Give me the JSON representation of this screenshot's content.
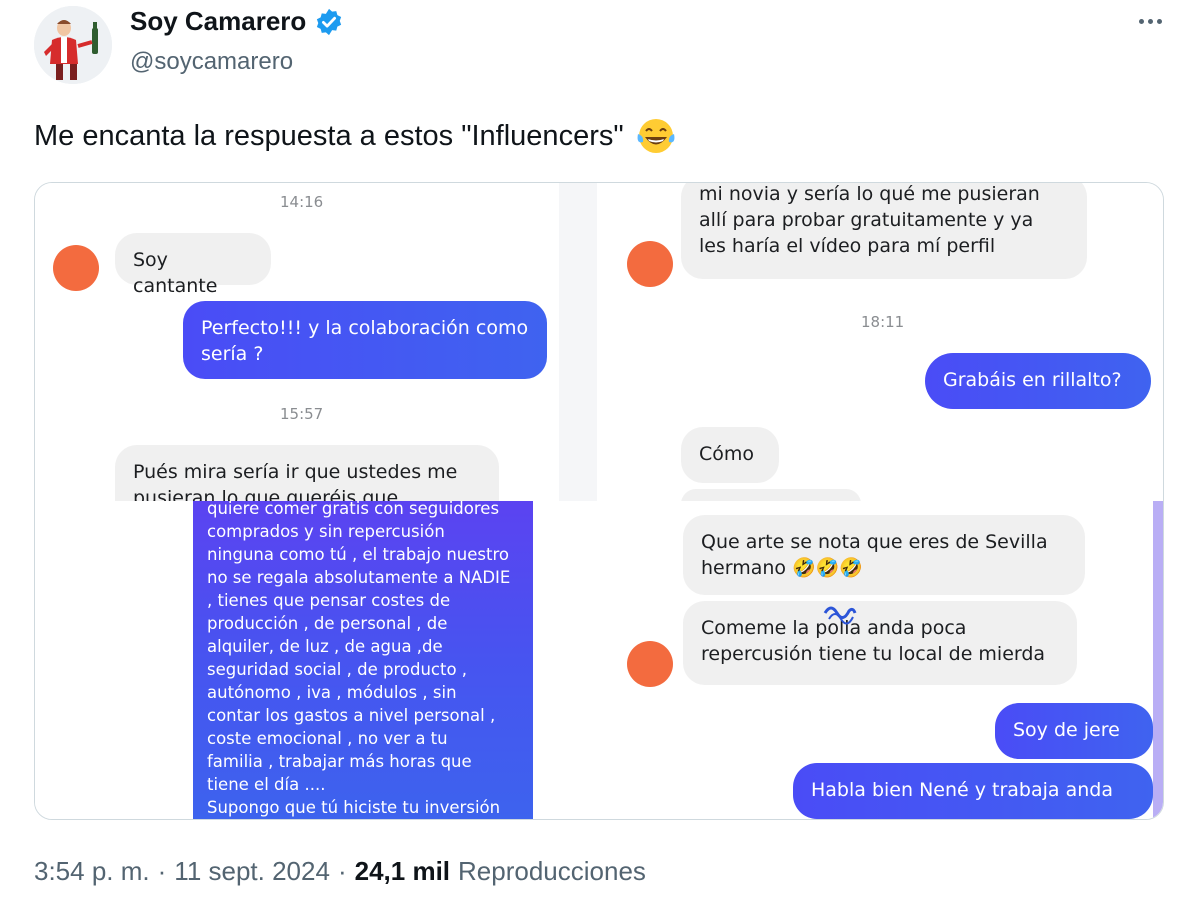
{
  "author": {
    "display_name": "Soy Camarero",
    "handle": "@soycamarero",
    "verified_icon": "verified-badge-icon",
    "verified_color": "#1d9bf0",
    "avatar_icon": "waiter-avatar"
  },
  "tweet": {
    "text": "Me encanta la respuesta a estos \"Influencers\"",
    "emoji": "face-with-tears-of-joy-icon"
  },
  "media": {
    "top_left": {
      "time1": "14:16",
      "msg_in_1": "Soy cantante",
      "msg_out_1_line1": "Perfecto!!! y la colaboración como",
      "msg_out_1_line2": "sería ?",
      "time2": "15:57",
      "msg_in_2_line1": "Pués mira sería ir que ustedes me",
      "msg_in_2_line2": "pusieran lo que queréis que"
    },
    "top_right": {
      "msg_in_1_line1": "mi novia y sería lo qué me pusieran",
      "msg_in_1_line2": "allí para probar gratuitamente y ya",
      "msg_in_1_line3": "les haría el vídeo para mí perfil",
      "time": "18:11",
      "msg_out_1": "Grabáis en rillalto?",
      "msg_in_2": "Cómo"
    },
    "bottom_left": {
      "lines": [
        "quiere comer gratis con seguidores",
        "comprados y sin repercusión",
        "ninguna como tú , el trabajo nuestro",
        "no se regala absolutamente a NADIE",
        ", tienes que pensar costes de",
        "producción , de personal , de",
        "alquiler, de luz , de agua ,de",
        "seguridad social , de producto ,",
        "autónomo , iva , módulos , sin",
        "contar los gastos a nivel personal ,",
        "coste emocional , no ver a tu",
        "familia , trabajar más horas que",
        "tiene el día ....",
        "Supongo que tú hiciste tu inversión"
      ]
    },
    "bottom_right": {
      "msg_in_1_line1": "Que arte se nota que eres de Sevilla",
      "msg_in_1_line2": "hermano 🤣🤣🤣",
      "msg_in_2_line1": "Comeme la polla anda poca",
      "msg_in_2_line2": "repercusión tiene tu local de mierda",
      "msg_out_1": "Soy de jere",
      "msg_out_2": "Habla bien Nené y trabaja anda"
    }
  },
  "meta": {
    "time": "3:54 p. m.",
    "date": "11 sept. 2024",
    "views_count": "24,1 mil",
    "views_label": "Reproducciones"
  }
}
